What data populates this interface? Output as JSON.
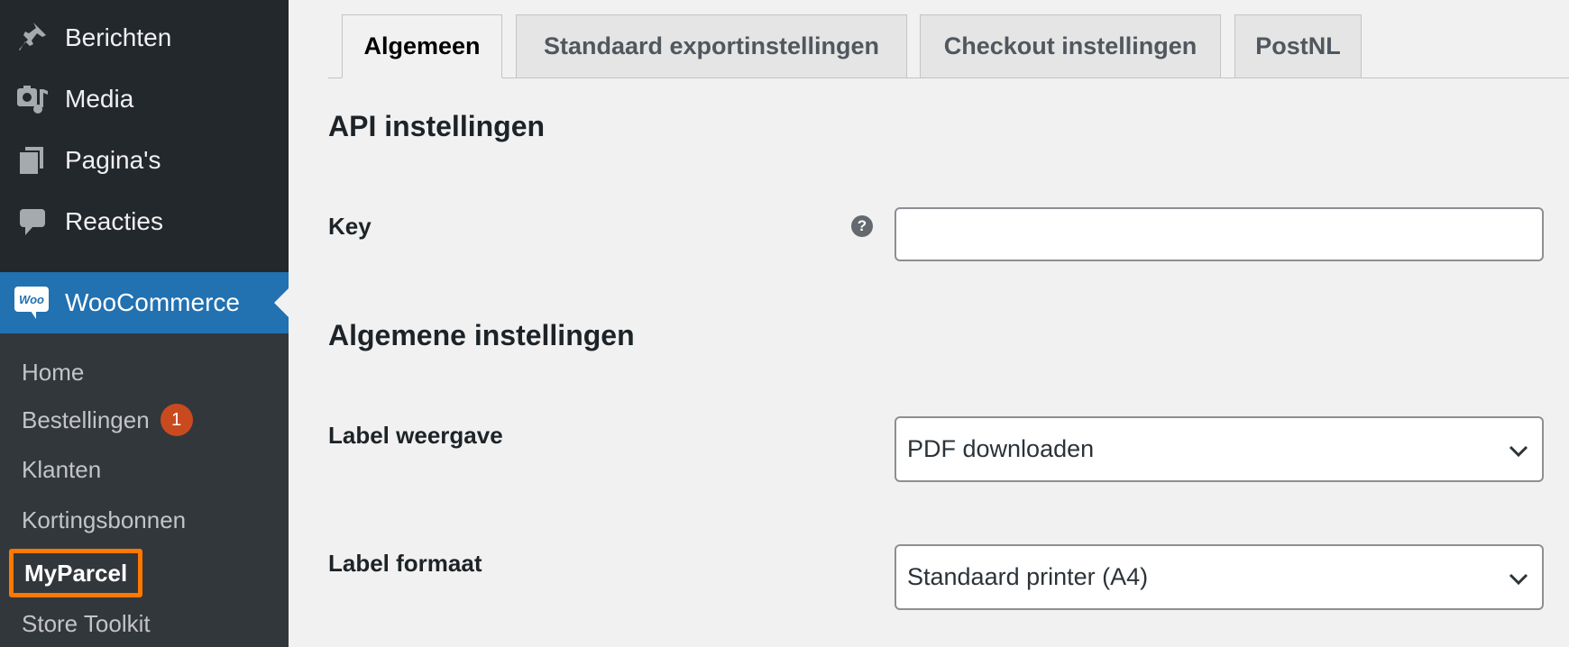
{
  "sidebar": {
    "menu": [
      {
        "label": "Berichten",
        "icon": "pin-icon"
      },
      {
        "label": "Media",
        "icon": "media-icon"
      },
      {
        "label": "Pagina's",
        "icon": "pages-icon"
      },
      {
        "label": "Reacties",
        "icon": "comments-icon"
      }
    ],
    "woocommerce": {
      "label": "WooCommerce",
      "icon_text": "Woo"
    },
    "submenu": [
      {
        "label": "Home"
      },
      {
        "label": "Bestellingen",
        "badge": "1"
      },
      {
        "label": "Klanten"
      },
      {
        "label": "Kortingsbonnen"
      },
      {
        "label": "MyParcel"
      },
      {
        "label": "Store Toolkit"
      }
    ]
  },
  "tabs": [
    {
      "label": "Algemeen",
      "active": true
    },
    {
      "label": "Standaard exportinstellingen"
    },
    {
      "label": "Checkout instellingen"
    },
    {
      "label": "PostNL"
    }
  ],
  "sections": {
    "api": {
      "title": "API instellingen"
    },
    "general": {
      "title": "Algemene instellingen"
    }
  },
  "fields": {
    "key": {
      "label": "Key",
      "value": "",
      "help": "?"
    },
    "label_display": {
      "label": "Label weergave",
      "value": "PDF downloaden"
    },
    "label_format": {
      "label": "Label formaat",
      "value": "Standaard printer (A4)"
    }
  },
  "colors": {
    "sidebar_bg": "#23282d",
    "submenu_bg": "#32373c",
    "accent": "#2271b1",
    "highlight": "#ff7800",
    "badge": "#ca4a1f"
  }
}
